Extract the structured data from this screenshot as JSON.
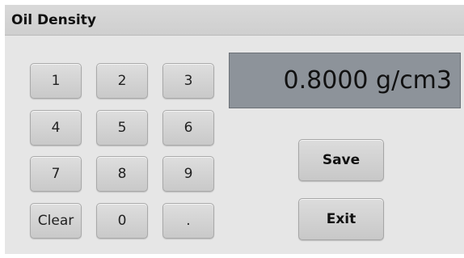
{
  "header": {
    "title": "Oil Density"
  },
  "display": {
    "value": "0.8000 g/cm3"
  },
  "keypad": {
    "keys": [
      "1",
      "2",
      "3",
      "4",
      "5",
      "6",
      "7",
      "8",
      "9",
      "Clear",
      "0",
      "."
    ]
  },
  "actions": {
    "save_label": "Save",
    "exit_label": "Exit"
  }
}
